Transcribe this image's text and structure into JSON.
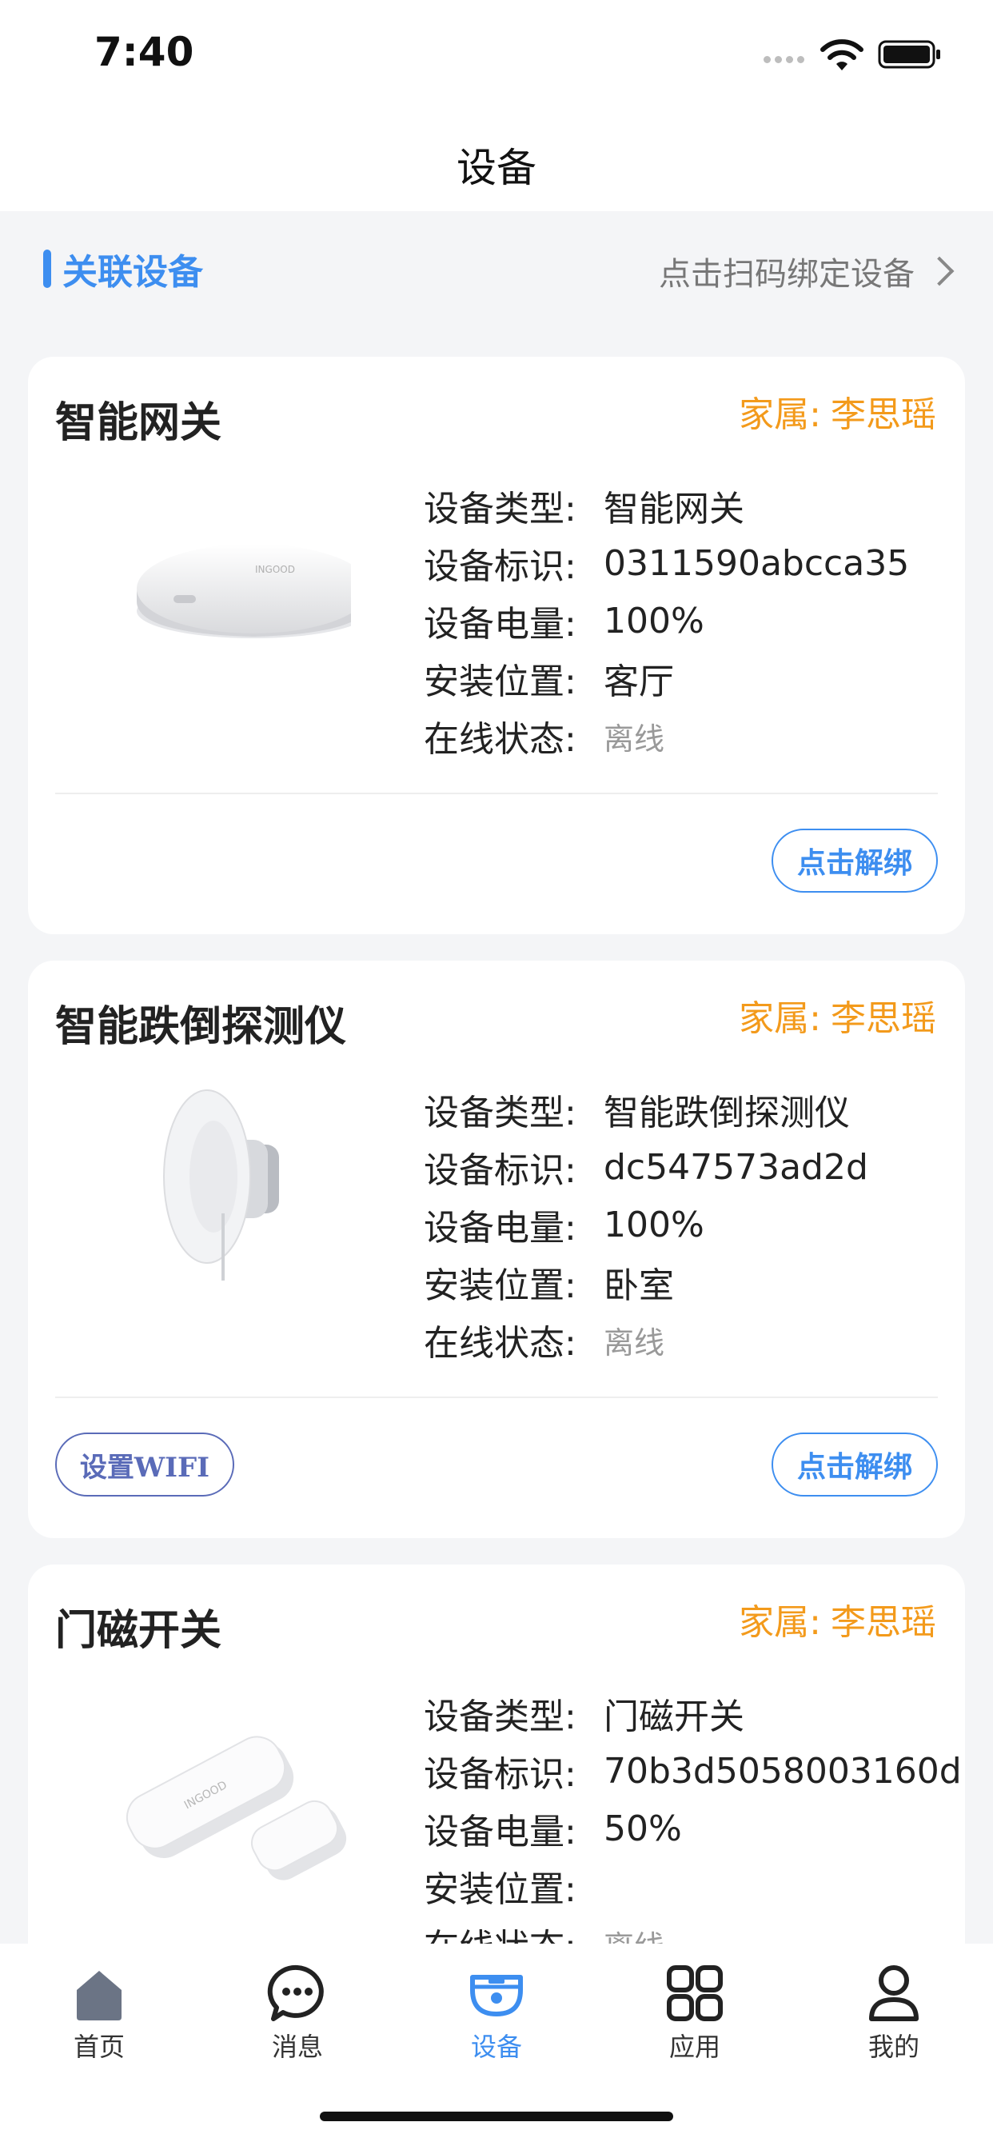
{
  "status_bar": {
    "time": "7:40"
  },
  "nav": {
    "title": "设备"
  },
  "section": {
    "title": "关联设备",
    "scan_link": "点击扫码绑定设备"
  },
  "field_labels": {
    "type": "设备类型:",
    "id": "设备标识:",
    "battery": "设备电量:",
    "location": "安装位置:",
    "status": "在线状态:"
  },
  "owner_label": "家属:",
  "devices": [
    {
      "name": "智能网关",
      "owner": "李思瑶",
      "type": "智能网关",
      "id": "0311590abcca35",
      "battery": "100%",
      "location": "客厅",
      "status": "离线",
      "unbind_label": "点击解绑",
      "image_icon": "gateway-device-image"
    },
    {
      "name": "智能跌倒探测仪",
      "owner": "李思瑶",
      "type": "智能跌倒探测仪",
      "id": "dc547573ad2d",
      "battery": "100%",
      "location": "卧室",
      "status": "离线",
      "unbind_label": "点击解绑",
      "wifi_label": "设置WIFI",
      "image_icon": "fall-detector-device-image"
    },
    {
      "name": "门磁开关",
      "owner": "李思瑶",
      "type": "门磁开关",
      "id": "70b3d5058003160d",
      "battery": "50%",
      "location": "",
      "status": "离线",
      "image_icon": "door-sensor-device-image"
    }
  ],
  "tabs": [
    {
      "label": "首页",
      "icon": "home-icon"
    },
    {
      "label": "消息",
      "icon": "message-icon"
    },
    {
      "label": "设备",
      "icon": "device-icon",
      "active": true
    },
    {
      "label": "应用",
      "icon": "apps-icon"
    },
    {
      "label": "我的",
      "icon": "profile-icon"
    }
  ],
  "colors": {
    "accent": "#3d8ef0",
    "owner": "#f39a1b",
    "status_offline": "#999999",
    "background": "#f4f5f7"
  }
}
